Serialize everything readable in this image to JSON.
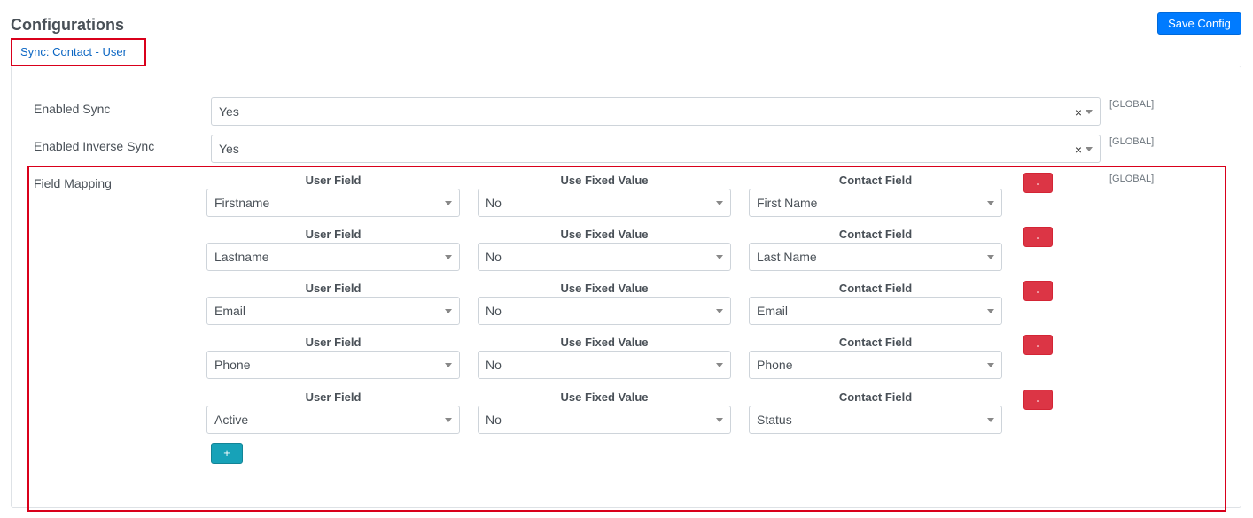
{
  "header": {
    "title": "Configurations",
    "save_label": "Save Config"
  },
  "tab": {
    "label": "Sync: Contact - User"
  },
  "settings": {
    "enabled_sync": {
      "label": "Enabled Sync",
      "value": "Yes",
      "clear": "×",
      "scope": "[GLOBAL]"
    },
    "enabled_inverse_sync": {
      "label": "Enabled Inverse Sync",
      "value": "Yes",
      "clear": "×",
      "scope": "[GLOBAL]"
    }
  },
  "field_mapping": {
    "label": "Field Mapping",
    "scope": "[GLOBAL]",
    "headers": {
      "user_field": "User Field",
      "use_fixed_value": "Use Fixed Value",
      "contact_field": "Contact Field"
    },
    "remove_label": "-",
    "add_label": "+",
    "rows": [
      {
        "user_field": "Firstname",
        "fixed": "No",
        "contact_field": "First Name"
      },
      {
        "user_field": "Lastname",
        "fixed": "No",
        "contact_field": "Last Name"
      },
      {
        "user_field": "Email",
        "fixed": "No",
        "contact_field": "Email"
      },
      {
        "user_field": "Phone",
        "fixed": "No",
        "contact_field": "Phone"
      },
      {
        "user_field": "Active",
        "fixed": "No",
        "contact_field": "Status"
      }
    ]
  },
  "colors": {
    "primary": "#007bff",
    "danger": "#dc3545",
    "info": "#17a2b8",
    "highlight": "#d9001b",
    "tab_text": "#0b66c3"
  }
}
